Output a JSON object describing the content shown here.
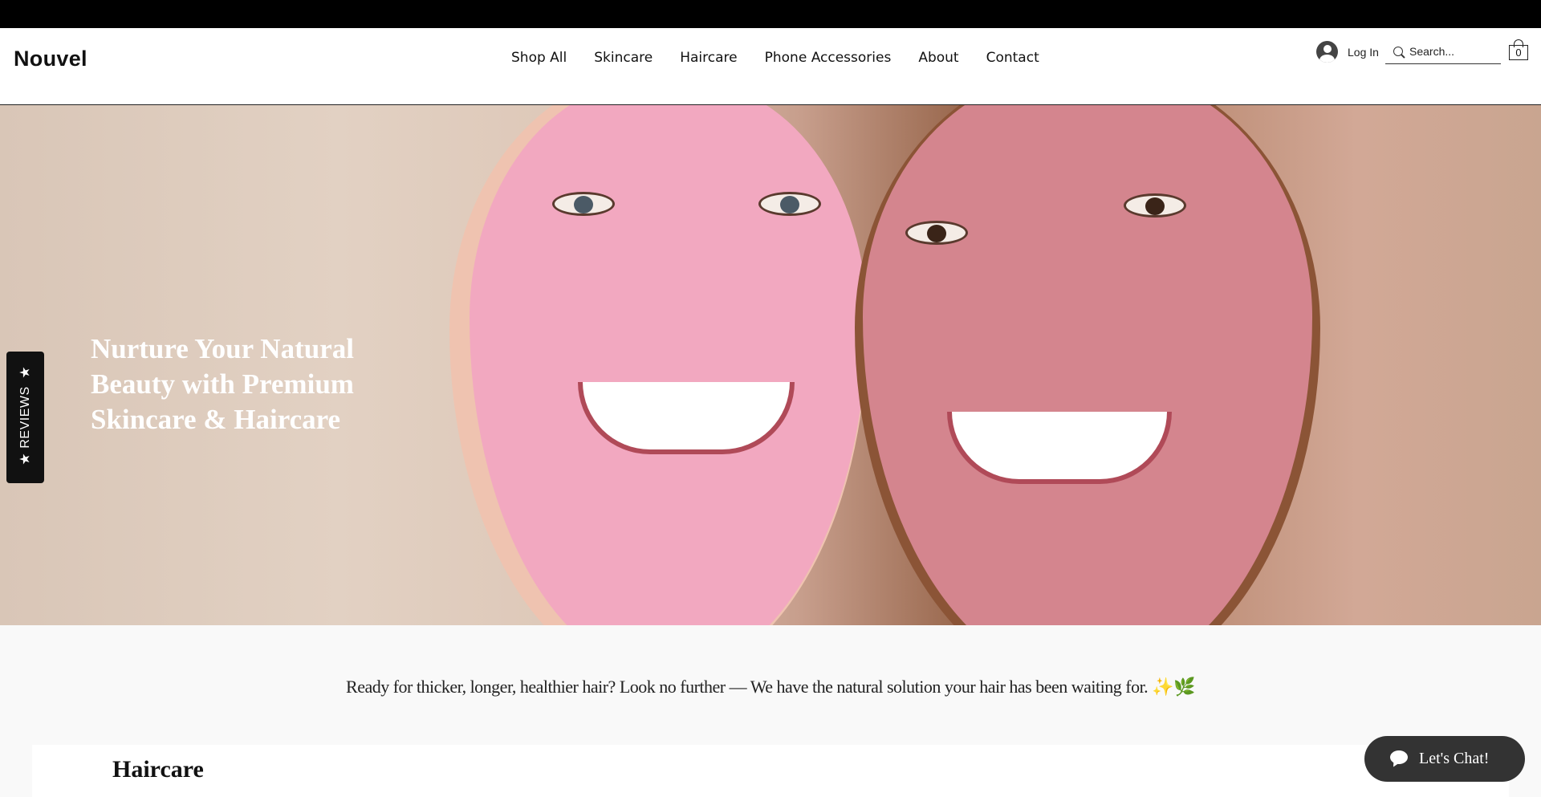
{
  "brand": {
    "logo": "Nouvel"
  },
  "nav": {
    "items": [
      {
        "label": "Shop All"
      },
      {
        "label": "Skincare"
      },
      {
        "label": "Haircare"
      },
      {
        "label": "Phone Accessories"
      },
      {
        "label": "About"
      },
      {
        "label": "Contact"
      }
    ]
  },
  "account": {
    "login_label": "Log In"
  },
  "search": {
    "placeholder": "Search..."
  },
  "cart": {
    "count": "0"
  },
  "hero": {
    "heading": "Nurture Your Natural Beauty with Premium Skincare & Haircare"
  },
  "reviews_tab": {
    "label": "REVIEWS",
    "icon": "star-icon"
  },
  "tagline": {
    "text": "Ready for thicker, longer, healthier hair? Look no further — We have the natural solution your hair has been waiting for. ✨🌿"
  },
  "section": {
    "title": "Haircare"
  },
  "chat": {
    "label": "Let's Chat!"
  },
  "colors": {
    "top_bar": "#000000",
    "chat_button": "#333333",
    "hero_text": "#ffffff"
  }
}
